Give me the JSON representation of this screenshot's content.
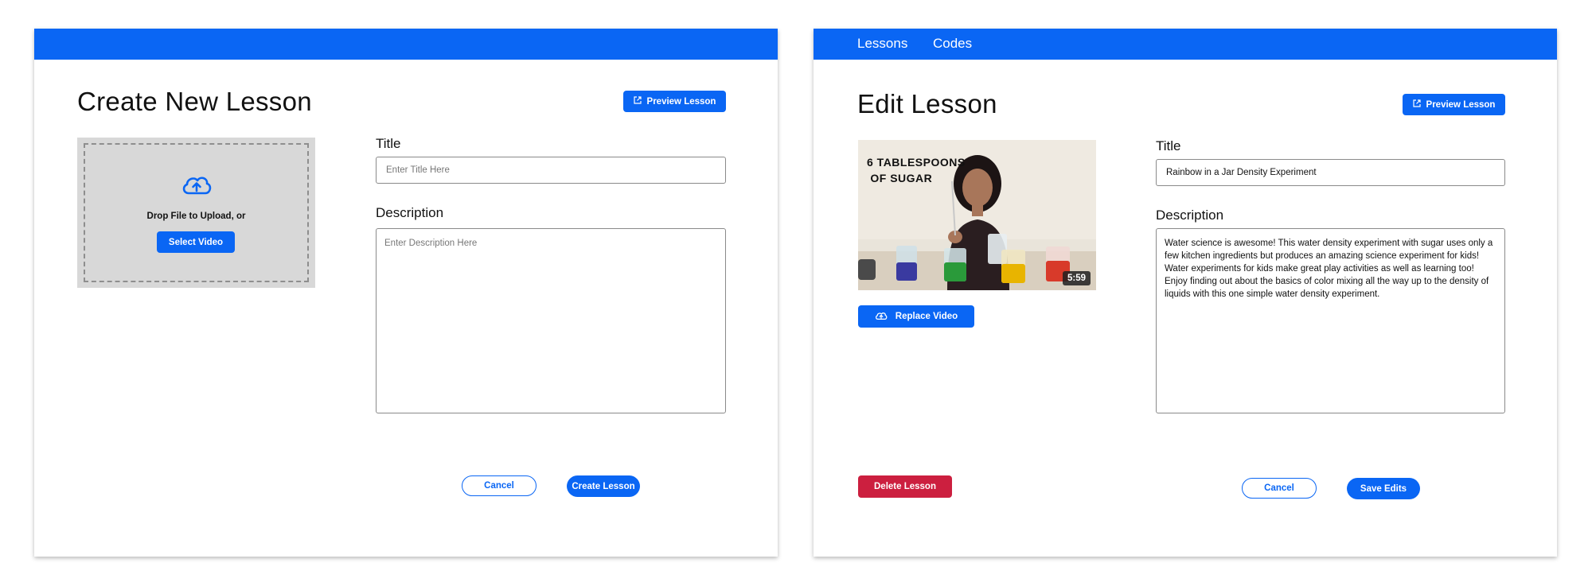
{
  "create": {
    "title": "Create New Lesson",
    "preview_label": "Preview Lesson",
    "upload": {
      "drop_text": "Drop File to Upload, or",
      "select_label": "Select Video"
    },
    "title_label": "Title",
    "title_placeholder": "Enter Title Here",
    "description_label": "Description",
    "description_placeholder": "Enter Description Here",
    "cancel_label": "Cancel",
    "create_label": "Create Lesson"
  },
  "edit": {
    "nav": [
      {
        "label": "Lessons"
      },
      {
        "label": "Codes"
      }
    ],
    "title": "Edit Lesson",
    "preview_label": "Preview Lesson",
    "video": {
      "caption": "6 TABLESPOONS\n OF SUGAR",
      "duration": "5:59",
      "replace_label": "Replace Video"
    },
    "title_label": "Title",
    "title_value": "Rainbow in a Jar Density Experiment",
    "description_label": "Description",
    "description_value": "Water science is awesome! This water density experiment with sugar uses only a few kitchen ingredients but produces an amazing science experiment for kids! Water experiments for kids make great play activities as well as learning too! Enjoy finding out about the basics of color mixing all the way up to the density of liquids with this one simple water density experiment.",
    "delete_label": "Delete Lesson",
    "cancel_label": "Cancel",
    "save_label": "Save Edits"
  },
  "icons": {
    "external_link": "external-link-icon",
    "upload": "cloud-upload-icon"
  },
  "colors": {
    "primary": "#0a66f4",
    "danger": "#cc1f3f",
    "dropzone": "#d8d8d8"
  }
}
